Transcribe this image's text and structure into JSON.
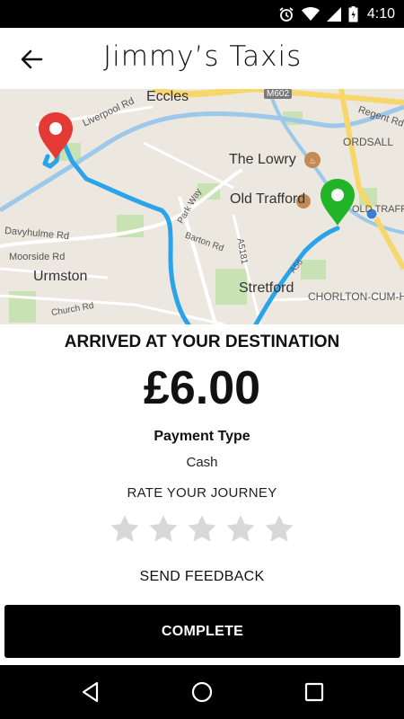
{
  "status_bar": {
    "time": "4:10",
    "icons": [
      "alarm-icon",
      "wifi-icon",
      "cell-signal-icon",
      "battery-icon"
    ]
  },
  "app_bar": {
    "title": "Jimmy’s Taxis",
    "back_icon": "arrow-back-icon"
  },
  "map": {
    "labels": {
      "eccles": "Eccles",
      "m602": "M602",
      "liverpool_rd": "Liverpool Rd",
      "regent_rd": "Regent Rd",
      "ordsall": "ORDSALL",
      "the_lowry": "The Lowry",
      "old_trafford": "Old Trafford",
      "old_traff": "OLD TRAFF",
      "park_way": "Park Way",
      "davyhulme_rd": "Davyhulme Rd",
      "barton_rd": "Barton Rd",
      "a5181": "A5181",
      "moorside_rd": "Moorside Rd",
      "urmston": "Urmston",
      "stretford": "Stretford",
      "chorlton": "CHORLTON-CUM-HA",
      "church_rd": "Church Rd",
      "a56": "A56"
    },
    "colors": {
      "route": "#2aa3ea",
      "start_pin": "#e53935",
      "end_pin": "#21b427",
      "location_dot": "#3b7ddd"
    }
  },
  "trip": {
    "status": "ARRIVED AT YOUR DESTINATION",
    "fare": "£6.00",
    "payment_type_label": "Payment Type",
    "payment_type_value": "Cash",
    "rate_label": "RATE YOUR JOURNEY",
    "rating": 0,
    "max_rating": 5,
    "feedback_label": "SEND FEEDBACK",
    "complete_label": "COMPLETE"
  },
  "nav_bar": {
    "back": "nav-back-icon",
    "home": "nav-home-icon",
    "recents": "nav-recents-icon"
  }
}
